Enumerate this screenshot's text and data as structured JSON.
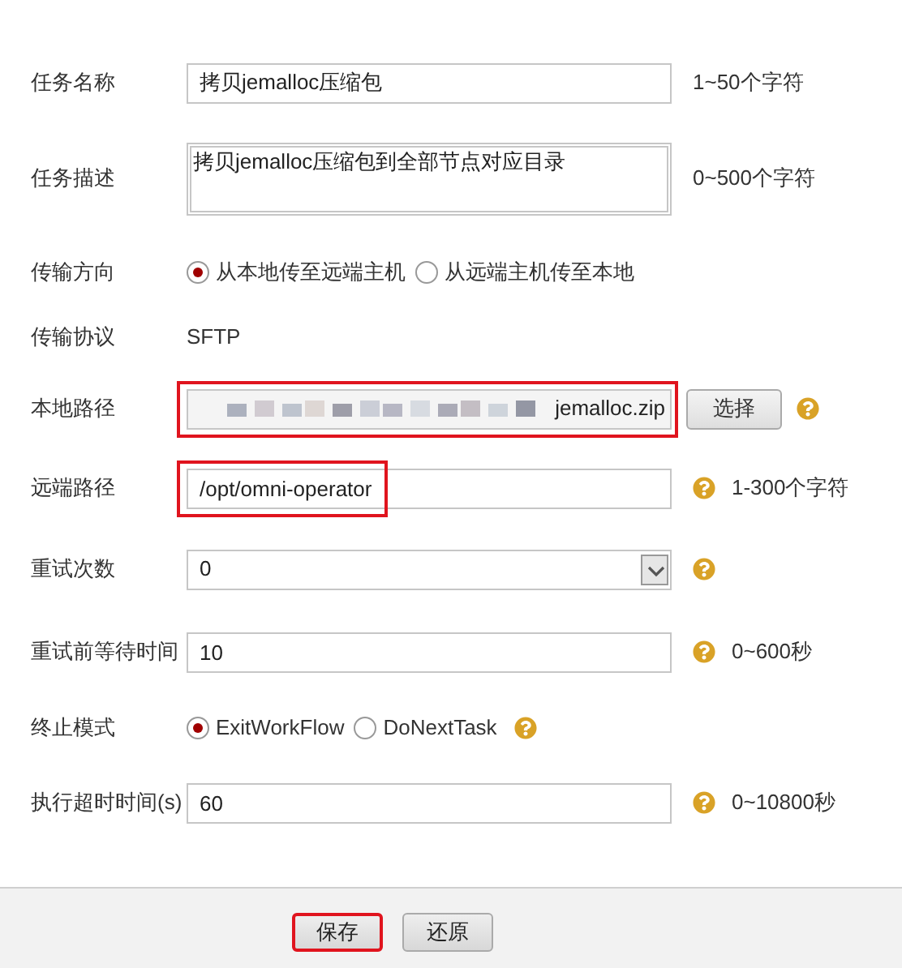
{
  "rows": [
    {
      "kind": "text",
      "label": "任务名称",
      "value": "拷贝jemalloc压缩包",
      "help": false,
      "hint": "1~50个字符",
      "highlighted": false
    },
    {
      "kind": "textarea",
      "label": "任务描述",
      "value": "拷贝jemalloc压缩包到全部节点对应目录",
      "help": false,
      "hint": "0~500个字符",
      "highlighted": false
    },
    {
      "kind": "radio",
      "label": "传输方向",
      "options": [
        {
          "label": "从本地传至远端主机",
          "selected": true
        },
        {
          "label": "从远端主机传至本地",
          "selected": false
        }
      ],
      "help": false
    },
    {
      "kind": "static",
      "label": "传输协议",
      "value": "SFTP"
    },
    {
      "kind": "file",
      "label": "本地路径",
      "value": "jemalloc.zip",
      "button": "选择",
      "help": true,
      "highlighted": true
    },
    {
      "kind": "text",
      "label": "远端路径",
      "value": "/opt/omni-operator",
      "help": true,
      "hint": "1-300个字符",
      "highlighted": true
    },
    {
      "kind": "select",
      "label": "重试次数",
      "value": "0",
      "help": true
    },
    {
      "kind": "text",
      "label": "重试前等待时间",
      "value": "10",
      "help": true,
      "hint": "0~600秒",
      "highlighted": false
    },
    {
      "kind": "radio",
      "label": "终止模式",
      "options": [
        {
          "label": "ExitWorkFlow",
          "selected": true
        },
        {
          "label": "DoNextTask",
          "selected": false
        }
      ],
      "help": true
    },
    {
      "kind": "text",
      "label": "执行超时时间(s)",
      "value": "60",
      "help": true,
      "hint": "0~10800秒",
      "highlighted": false
    }
  ],
  "buttons": [
    {
      "label": "保存",
      "focused": true
    },
    {
      "label": "还原",
      "focused": false
    }
  ]
}
